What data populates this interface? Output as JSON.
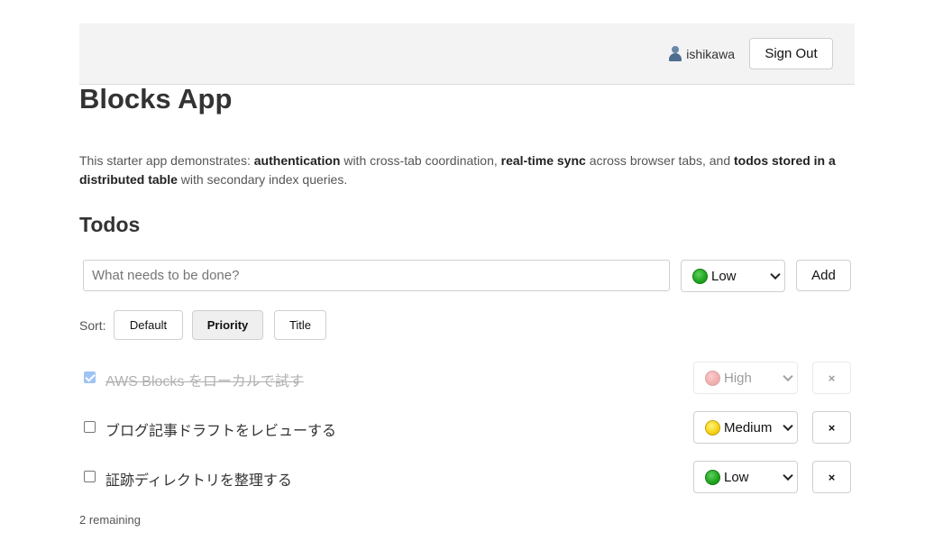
{
  "header": {
    "username": "ishikawa",
    "user_icon": "user-icon",
    "signout_label": "Sign Out"
  },
  "app": {
    "title": "Blocks App",
    "intro": {
      "p1": "This starter app demonstrates: ",
      "b1": "authentication",
      "p2": " with cross-tab coordination, ",
      "b2": "real-time sync",
      "p3": " across browser tabs, and ",
      "b3": "todos stored in a distributed table",
      "p4": " with secondary index queries."
    }
  },
  "todos_section": {
    "heading": "Todos",
    "input_placeholder": "What needs to be done?",
    "input_value": "",
    "new_priority": "Low",
    "new_priority_color": "green",
    "add_label": "Add"
  },
  "sort": {
    "label": "Sort:",
    "options": [
      {
        "label": "Default",
        "active": false
      },
      {
        "label": "Priority",
        "active": true
      },
      {
        "label": "Title",
        "active": false
      }
    ]
  },
  "todos": [
    {
      "text": "AWS Blocks をローカルで試す",
      "done": true,
      "priority": "High",
      "priority_color": "red"
    },
    {
      "text": "ブログ記事ドラフトをレビューする",
      "done": false,
      "priority": "Medium",
      "priority_color": "yellow"
    },
    {
      "text": "証跡ディレクトリを整理する",
      "done": false,
      "priority": "Low",
      "priority_color": "green"
    }
  ],
  "delete_label": "×",
  "remaining_text": "2 remaining",
  "colors": {
    "header_bg": "#f3f3f3",
    "checkbox_accent": "#1a73e8"
  }
}
